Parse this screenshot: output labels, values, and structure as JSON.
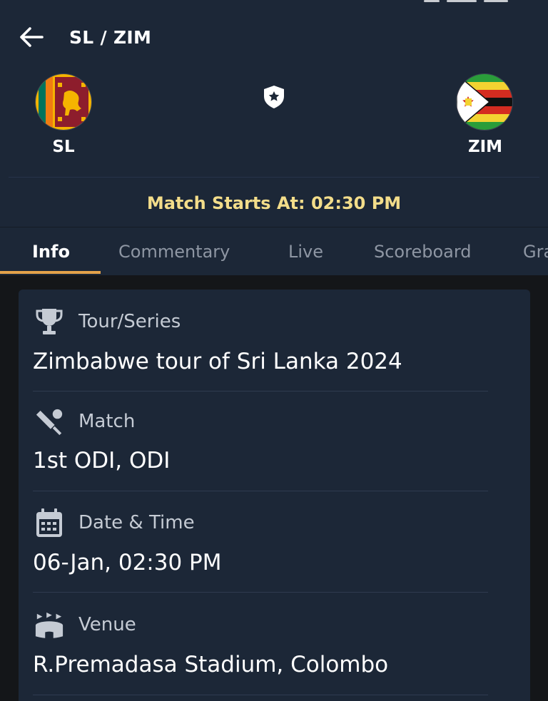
{
  "header": {
    "title": "SL / ZIM",
    "team_home": {
      "code": "SL"
    },
    "team_away": {
      "code": "ZIM"
    },
    "match_start": "Match Starts At: 02:30 PM"
  },
  "tabs": [
    {
      "label": "Info",
      "active": true
    },
    {
      "label": "Commentary"
    },
    {
      "label": "Live"
    },
    {
      "label": "Scoreboard"
    },
    {
      "label": "Gra"
    }
  ],
  "info": {
    "series_label": "Tour/Series",
    "series_value": "Zimbabwe tour of Sri Lanka 2024",
    "match_label": "Match",
    "match_value": "1st ODI, ODI",
    "datetime_label": "Date & Time",
    "datetime_value": "06-Jan, 02:30 PM",
    "venue_label": "Venue",
    "venue_value": "R.Premadasa Stadium, Colombo"
  },
  "icons": {
    "back": "arrow-left-icon",
    "favorite": "star-shield-icon",
    "series": "trophy-icon",
    "match": "cricket-bat-icon",
    "datetime": "calendar-icon",
    "venue": "stadium-icon"
  },
  "colors": {
    "background": "#141619",
    "header": "#1c2737",
    "accent": "#e3a24a",
    "highlight_text": "#f3dd8a",
    "icon": "#c5cbd4"
  }
}
